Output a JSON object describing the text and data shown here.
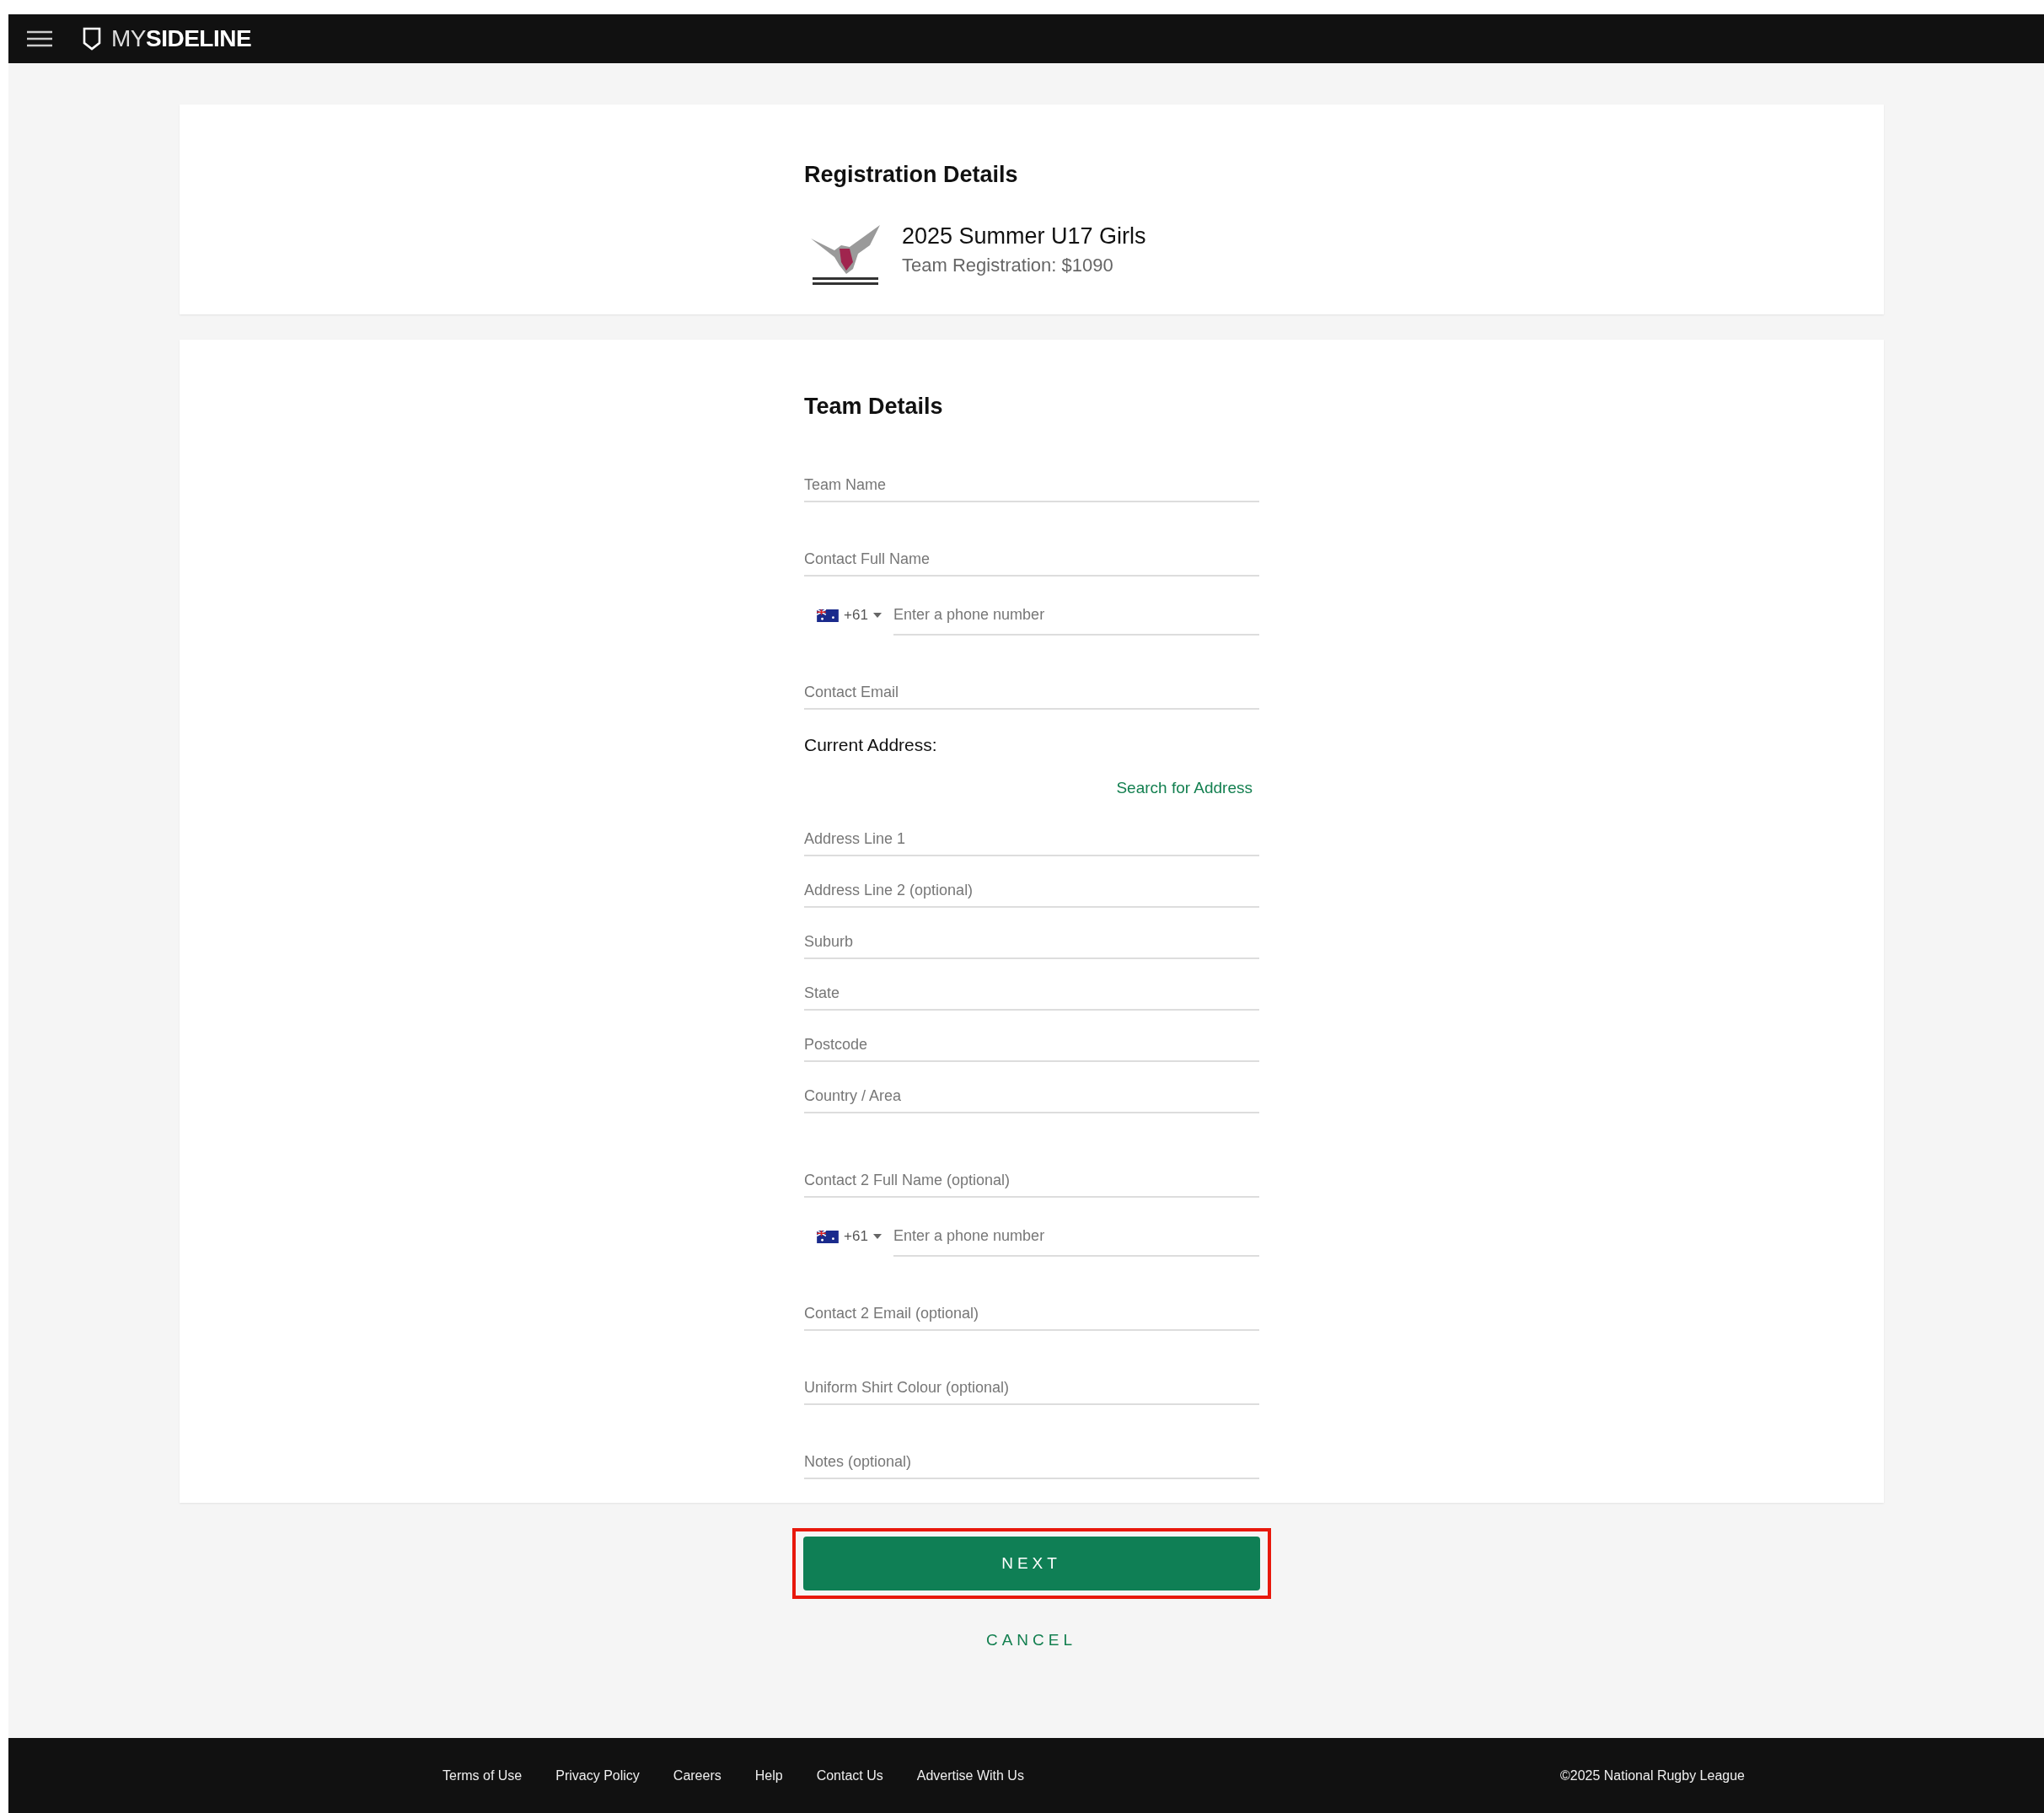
{
  "header": {
    "brand_light": "MY",
    "brand_bold": "SIDELINE"
  },
  "registration": {
    "heading": "Registration Details",
    "title": "2025 Summer U17 Girls",
    "subtitle": "Team Registration: $1090"
  },
  "team_details": {
    "heading": "Team Details",
    "fields": [
      {
        "kind": "text",
        "placeholder": "Team Name"
      },
      {
        "kind": "text",
        "placeholder": "Contact Full Name"
      },
      {
        "kind": "phone",
        "code": "+61",
        "placeholder": "Enter a phone number"
      },
      {
        "kind": "text",
        "placeholder": "Contact Email"
      }
    ],
    "address_heading": "Current Address:",
    "search_link": "Search for Address",
    "address_fields": [
      {
        "placeholder": "Address Line 1"
      },
      {
        "placeholder": "Address Line 2 (optional)"
      },
      {
        "placeholder": "Suburb"
      },
      {
        "placeholder": "State"
      },
      {
        "placeholder": "Postcode"
      },
      {
        "placeholder": "Country / Area"
      }
    ],
    "extra_fields": [
      {
        "kind": "text",
        "placeholder": "Contact 2 Full Name (optional)"
      },
      {
        "kind": "phone",
        "code": "+61",
        "placeholder": "Enter a phone number"
      },
      {
        "kind": "text",
        "placeholder": "Contact 2 Email (optional)"
      },
      {
        "kind": "text",
        "placeholder": "Uniform Shirt Colour (optional)"
      },
      {
        "kind": "text",
        "placeholder": "Notes (optional)"
      }
    ]
  },
  "next_button": {
    "label": "NEXT",
    "highlighted": true
  },
  "cancel_link": "CANCEL",
  "footer": {
    "links": [
      "Terms of Use",
      "Privacy Policy",
      "Careers",
      "Help",
      "Contact Us",
      "Advertise With Us"
    ],
    "copyright": "©2025 National Rugby League"
  }
}
